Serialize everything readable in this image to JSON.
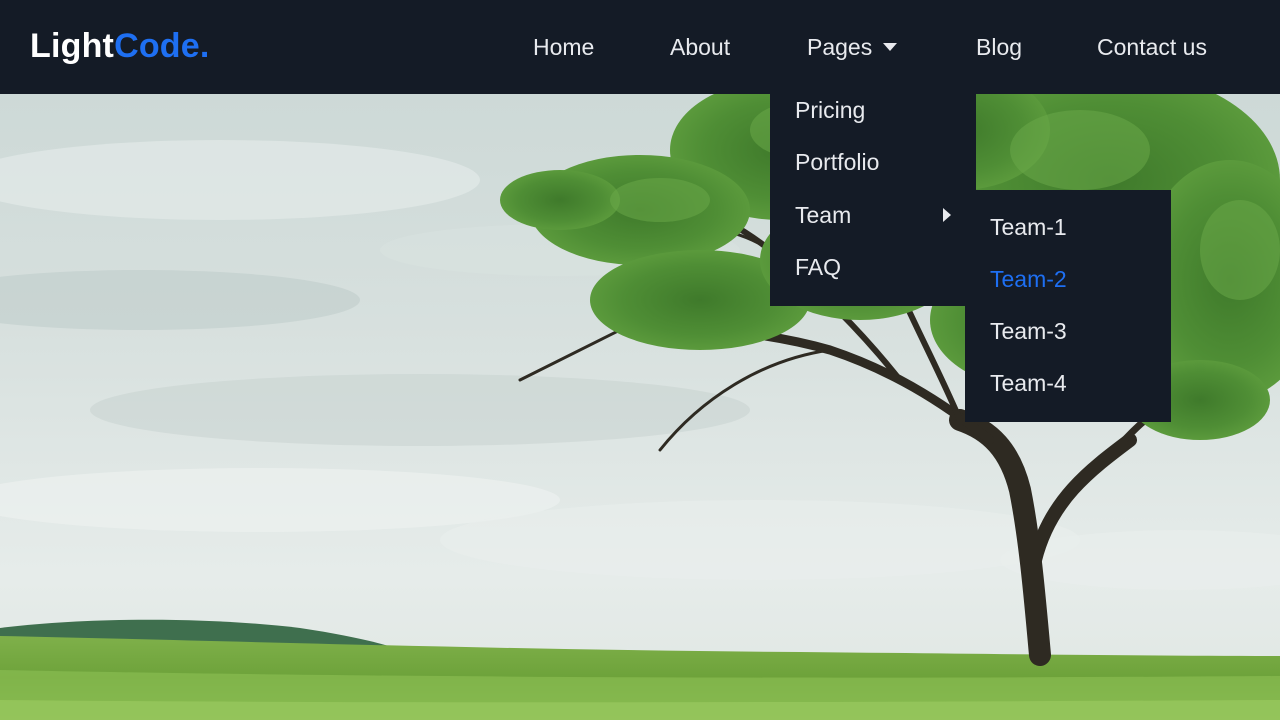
{
  "logo": {
    "part1": "Light",
    "part2": "Code."
  },
  "nav": {
    "home": "Home",
    "about": "About",
    "pages": "Pages",
    "blog": "Blog",
    "contact": "Contact us"
  },
  "pages_menu": {
    "items": [
      "Pricing",
      "Portfolio",
      "Team",
      "FAQ"
    ]
  },
  "team_menu": {
    "items": [
      "Team-1",
      "Team-2",
      "Team-3",
      "Team-4"
    ],
    "active": "Team-2"
  },
  "icons": {
    "pages_dropdown": "caret-down-icon",
    "team_submenu": "caret-right-icon"
  },
  "colors": {
    "navbar_bg": "#141b26",
    "accent": "#1e6ff2",
    "text": "#e8eaee"
  }
}
